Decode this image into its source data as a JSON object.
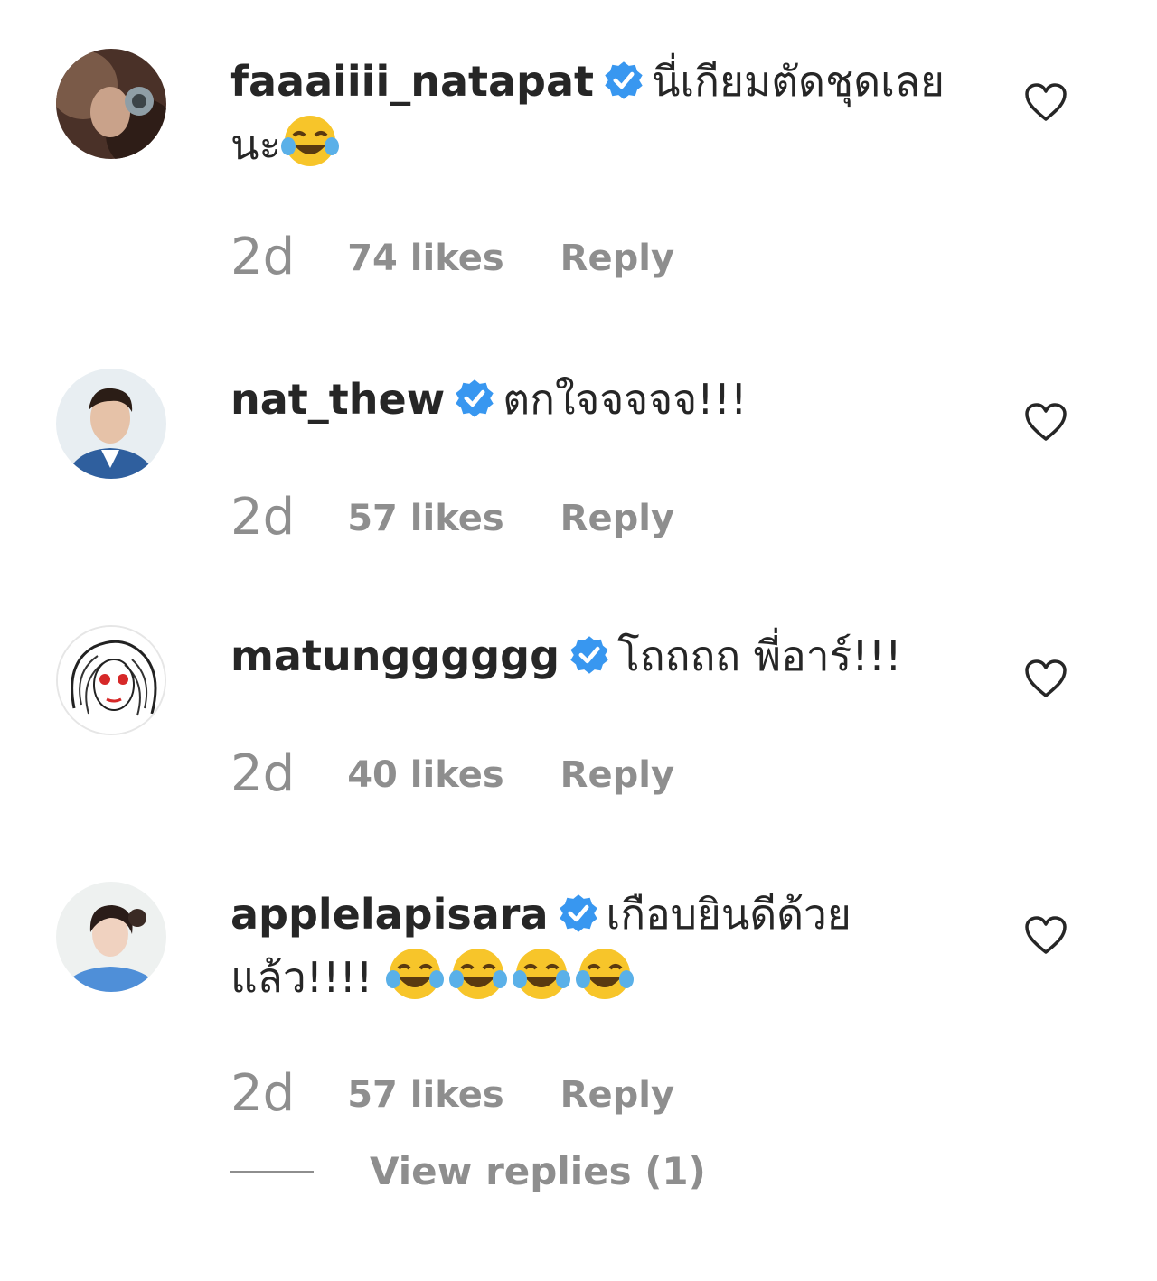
{
  "comments": [
    {
      "username": "faaaiiii_natapat",
      "text": "นี่เกียมตัดชุดเลยนะ",
      "emoji_count": 1,
      "time": "2d",
      "likes": "74 likes",
      "reply": "Reply"
    },
    {
      "username": "nat_thew",
      "text": "ตกใจจจจจ!!!",
      "emoji_count": 0,
      "time": "2d",
      "likes": "57 likes",
      "reply": "Reply"
    },
    {
      "username": "matungggggg",
      "text": "โถถถถ พี่อาร์!!!",
      "emoji_count": 0,
      "time": "2d",
      "likes": "40 likes",
      "reply": "Reply"
    },
    {
      "username": "applelapisara",
      "text": "เกือบยินดีด้วยแล้ว!!!!",
      "emoji_count": 4,
      "time": "2d",
      "likes": "57 likes",
      "reply": "Reply"
    }
  ],
  "view_replies": "View replies (1)",
  "icons": {
    "verified": "verified-badge-icon",
    "like": "heart-outline-icon",
    "emoji": "face-with-tears-of-joy"
  },
  "colors": {
    "text_primary": "#262626",
    "text_secondary": "#8e8e8e",
    "verified_blue": "#3897f0"
  }
}
